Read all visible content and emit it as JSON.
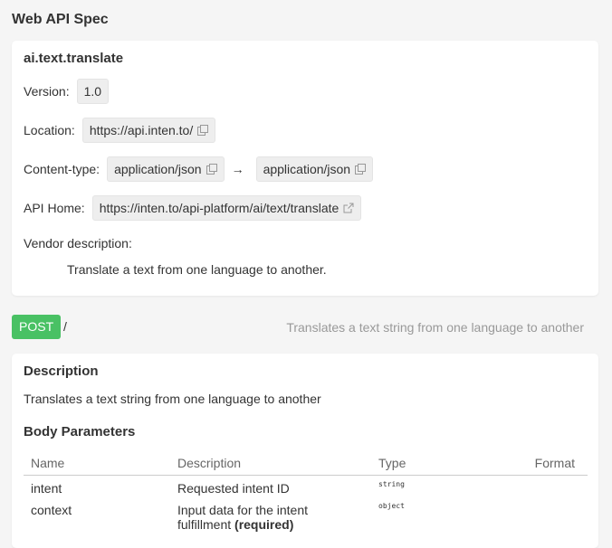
{
  "page_title": "Web API Spec",
  "api": {
    "name": "ai.text.translate",
    "version_label": "Version:",
    "version": "1.0",
    "location_label": "Location:",
    "location": "https://api.inten.to/",
    "content_type_label": "Content-type:",
    "content_type_in": "application/json",
    "content_type_arrow": "→",
    "content_type_out": "application/json",
    "home_label": "API Home:",
    "home": "https://inten.to/api-platform/ai/text/translate",
    "vendor_desc_label": "Vendor description:",
    "vendor_desc": "Translate a text from one language to another."
  },
  "endpoint": {
    "method": "POST",
    "path": "/",
    "summary": "Translates a text string from one language to another",
    "method_color": "#49c164"
  },
  "details": {
    "description_title": "Description",
    "description": "Translates a text string from one language to another",
    "body_params_title": "Body Parameters",
    "columns": [
      "Name",
      "Description",
      "Type",
      "Format"
    ],
    "rows": [
      {
        "name": "intent",
        "description": "Requested intent ID",
        "required": "",
        "type": "string"
      },
      {
        "name": "context",
        "description": "Input data for the intent fulfillment",
        "required": "(required)",
        "type": "object"
      }
    ]
  },
  "icons": {
    "copy": "copy-icon",
    "external_link": "external-link-icon"
  }
}
